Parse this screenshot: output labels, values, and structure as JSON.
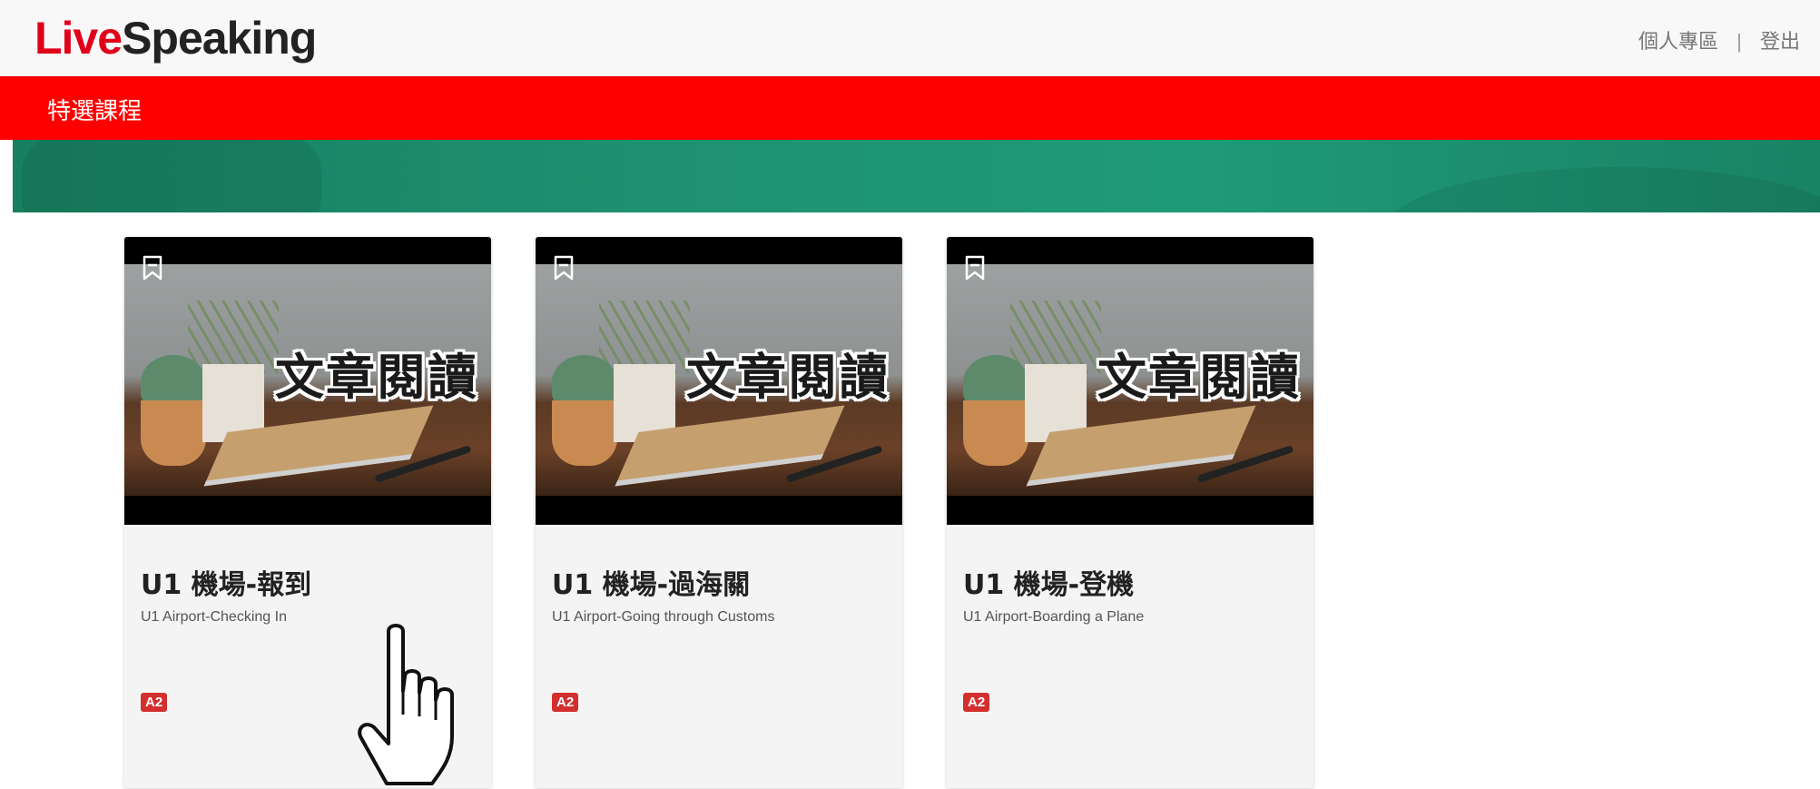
{
  "brand": {
    "logo_live": "Live",
    "logo_speaking": "Speaking"
  },
  "header": {
    "personal_link": "個人專區",
    "separator": "|",
    "logout_link": "登出"
  },
  "nav": {
    "featured_courses": "特選課程"
  },
  "colors": {
    "brand_red": "#fe0000",
    "banner_green": "#1e9170",
    "level_badge": "#d32f2f"
  },
  "courses": [
    {
      "thumb_text": "文章閱讀",
      "title": "U1 機場-報到",
      "subtitle": "U1 Airport-Checking In",
      "level": "A2",
      "icon": "bookmark-icon"
    },
    {
      "thumb_text": "文章閱讀",
      "title": "U1 機場-過海關",
      "subtitle": "U1 Airport-Going through Customs",
      "level": "A2",
      "icon": "bookmark-icon"
    },
    {
      "thumb_text": "文章閱讀",
      "title": "U1 機場-登機",
      "subtitle": "U1 Airport-Boarding a Plane",
      "level": "A2",
      "icon": "bookmark-icon"
    }
  ],
  "cursor": {
    "icon": "hand-pointer-icon"
  }
}
